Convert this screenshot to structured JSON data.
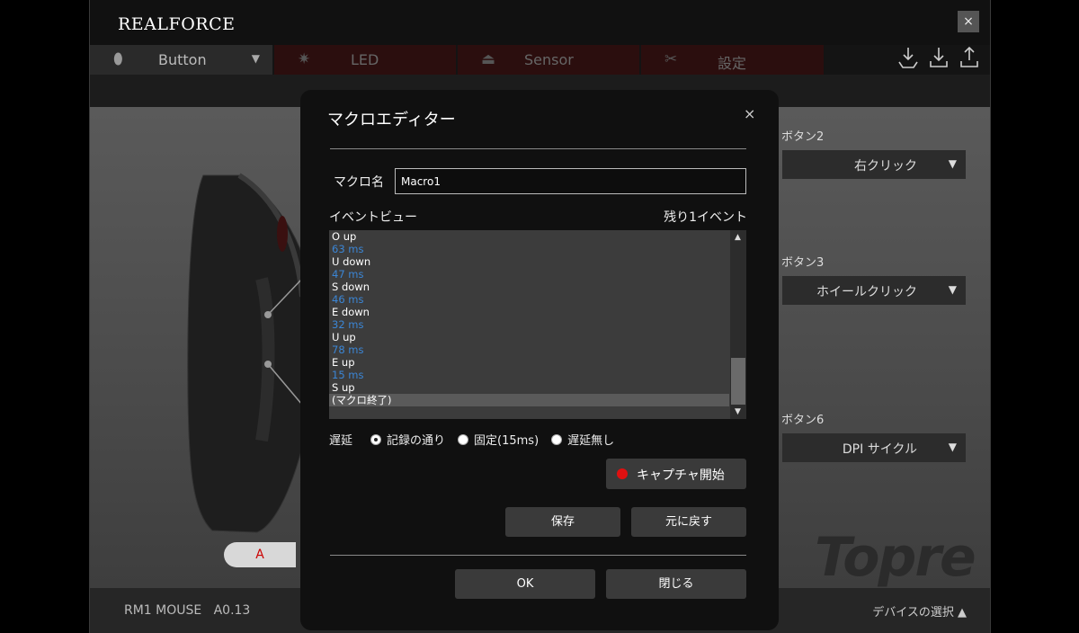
{
  "app": {
    "logo": "REALFORCE",
    "close_glyph": "×",
    "tabs": [
      {
        "label": "Button",
        "icon": "mouse-icon"
      },
      {
        "label": "LED",
        "icon": "sun-icon"
      },
      {
        "label": "Sensor",
        "icon": "sensor-icon"
      },
      {
        "label": "設定",
        "icon": "tools-icon"
      }
    ],
    "tab_dropdown_glyph": "▼"
  },
  "right_panel": {
    "buttons": [
      {
        "label": "ボタン2",
        "value": "右クリック"
      },
      {
        "label": "ボタン3",
        "value": "ホイールクリック"
      },
      {
        "label": "ボタン6",
        "value": "DPI サイクル"
      }
    ]
  },
  "profile_pill": "A",
  "brand_watermark": "Topre",
  "footer": {
    "device": "RM1 MOUSE   A0.13",
    "device_select": "デバイスの選択 ▲"
  },
  "macro_editor": {
    "title": "マクロエディター",
    "close_glyph": "×",
    "name_label": "マクロ名",
    "name_value": "Macro1",
    "event_view_label": "イベントビュー",
    "remaining": "残り1イベント",
    "events": [
      {
        "text": "O up",
        "kind": "key"
      },
      {
        "text": "63 ms",
        "kind": "ms"
      },
      {
        "text": "U down",
        "kind": "key"
      },
      {
        "text": "47 ms",
        "kind": "ms"
      },
      {
        "text": "S down",
        "kind": "key"
      },
      {
        "text": "46 ms",
        "kind": "ms"
      },
      {
        "text": "E down",
        "kind": "key"
      },
      {
        "text": "32 ms",
        "kind": "ms"
      },
      {
        "text": "U up",
        "kind": "key"
      },
      {
        "text": "78 ms",
        "kind": "ms"
      },
      {
        "text": "E up",
        "kind": "key"
      },
      {
        "text": "15 ms",
        "kind": "ms"
      },
      {
        "text": "S up",
        "kind": "key"
      },
      {
        "text": "(マクロ終了)",
        "kind": "end"
      }
    ],
    "delay_label": "遅延",
    "delay_options": [
      {
        "label": "記録の通り",
        "selected": true
      },
      {
        "label": "固定(15ms)",
        "selected": false
      },
      {
        "label": "遅延無し",
        "selected": false
      }
    ],
    "capture_label": "キャプチャ開始",
    "save_label": "保存",
    "revert_label": "元に戻す",
    "ok_label": "OK",
    "close_label": "閉じる",
    "colors": {
      "ms": "#3b86d6",
      "record": "#e01010"
    }
  }
}
